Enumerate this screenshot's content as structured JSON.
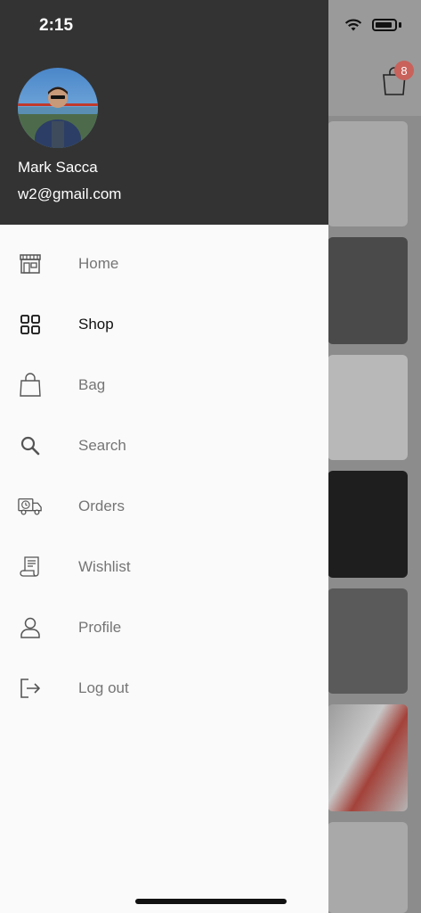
{
  "status_bar": {
    "time": "2:15"
  },
  "drawer": {
    "user": {
      "name": "Mark Sacca",
      "email": "w2@gmail.com"
    },
    "items": [
      {
        "label": "Home",
        "icon": "store-icon",
        "active": false
      },
      {
        "label": "Shop",
        "icon": "grid-icon",
        "active": true
      },
      {
        "label": "Bag",
        "icon": "bag-icon",
        "active": false
      },
      {
        "label": "Search",
        "icon": "search-icon",
        "active": false
      },
      {
        "label": "Orders",
        "icon": "truck-icon",
        "active": false
      },
      {
        "label": "Wishlist",
        "icon": "scroll-icon",
        "active": false
      },
      {
        "label": "Profile",
        "icon": "user-icon",
        "active": false
      },
      {
        "label": "Log out",
        "icon": "logout-icon",
        "active": false
      }
    ]
  },
  "background": {
    "bag_badge_count": "8"
  },
  "colors": {
    "drawer_header": "#333333",
    "drawer_bg": "#fafafa",
    "badge": "#c8625b"
  }
}
